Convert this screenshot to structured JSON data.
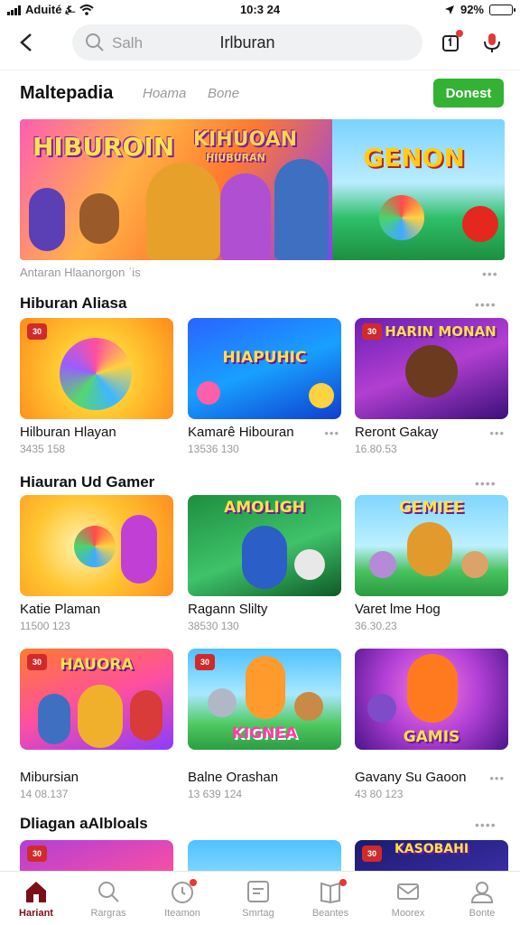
{
  "status": {
    "carrier": "Aduité ⍼",
    "time": "10:3 24",
    "battery": "92%",
    "battery_level": 0.92
  },
  "header": {
    "search_placeholder": "Salh",
    "search_query": "Irlburan"
  },
  "marketplace": {
    "title": "Maltepadia",
    "tabs": [
      "Hoama",
      "Bone"
    ],
    "button_label": "Donest"
  },
  "banner": {
    "title_left": "HIBUROIN",
    "title_mid": "KIHUOAN",
    "subtitle_mid": "HIUBURAN",
    "title_right": "GENON",
    "caption": "Antaran Hlaanorgon ʾis"
  },
  "sections": [
    {
      "title": "Hiburan Aliasa",
      "cards": [
        {
          "name": "Hilburan Hlayan",
          "meta": "3435 158",
          "badge": "30",
          "label": ""
        },
        {
          "name": "Kamarê Hibouran",
          "meta": "13536 130",
          "badge": "",
          "label": "HIAPUHIC"
        },
        {
          "name": "Reront Gakay",
          "meta": "16.80.53",
          "badge": "30",
          "label": "HARIN MONAN"
        }
      ]
    },
    {
      "title": "Hiauran Ud Gamer",
      "cards": [
        {
          "name": "Katie Plaman",
          "meta": "11500 123",
          "badge": "",
          "label": ""
        },
        {
          "name": "Ragann Slilty",
          "meta": "38530 130",
          "badge": "",
          "label": "AMOLIGH"
        },
        {
          "name": "Varet lme Hog",
          "meta": "36.30.23",
          "badge": "",
          "label": "GEMIEE"
        }
      ]
    },
    {
      "title": "",
      "cards": [
        {
          "name": "Mibursian",
          "meta": "14 08.137",
          "badge": "30",
          "label": "HAUORA"
        },
        {
          "name": "Balne Orashan",
          "meta": "13 639 124",
          "badge": "30",
          "label": "KIGNEA"
        },
        {
          "name": "Gavany Su Gaoon",
          "meta": "43 80 123",
          "badge": "",
          "label": "GAMIS"
        }
      ]
    },
    {
      "title": "Dliagan aAlbloals",
      "cards": [
        {
          "badge": "30",
          "label": ""
        },
        {
          "badge": "",
          "label": ""
        },
        {
          "badge": "30",
          "label": "KASOBAHI"
        }
      ]
    }
  ],
  "bottom_nav": [
    {
      "label": "Hariant",
      "icon": "home-icon"
    },
    {
      "label": "Rargras",
      "icon": "search-icon"
    },
    {
      "label": "Iteamon",
      "icon": "timer-icon"
    },
    {
      "label": "Smrtag",
      "icon": "list-icon"
    },
    {
      "label": "Beantes",
      "icon": "book-icon"
    },
    {
      "label": "Moorex",
      "icon": "mail-icon"
    },
    {
      "label": "Bonte",
      "icon": "user-icon"
    }
  ],
  "colors": {
    "accent_green": "#34b233",
    "active_nav": "#7a0f1a",
    "notification_red": "#e53935"
  }
}
